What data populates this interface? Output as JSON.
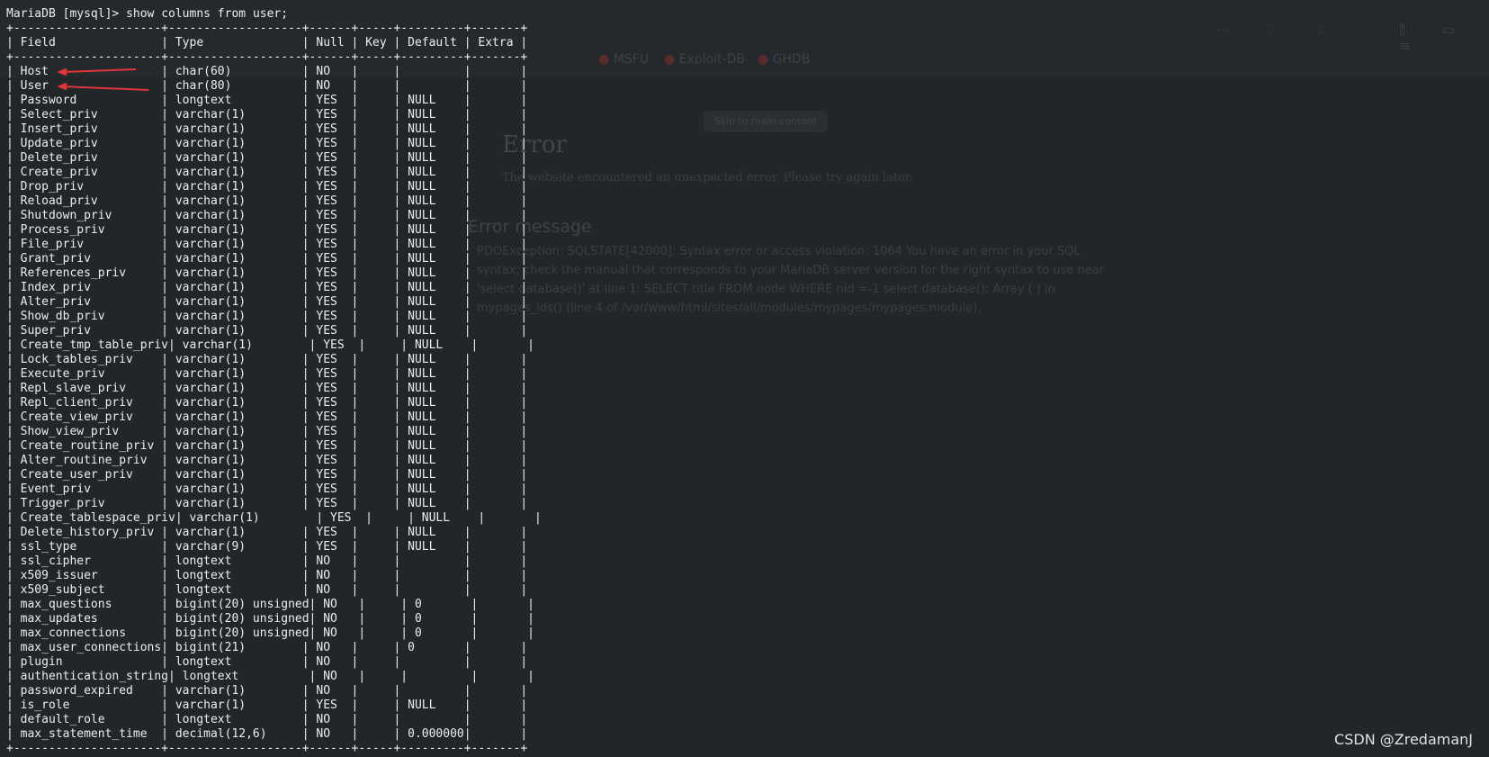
{
  "terminal": {
    "prompt": "MariaDB [mysql]> ",
    "command": "show columns from user;"
  },
  "table": {
    "columns": [
      "Field",
      "Type",
      "Null",
      "Key",
      "Default",
      "Extra"
    ],
    "widths": [
      21,
      19,
      6,
      5,
      9,
      7
    ],
    "rows": [
      [
        "Host",
        "char(60)",
        "NO",
        "",
        "",
        ""
      ],
      [
        "User",
        "char(80)",
        "NO",
        "",
        "",
        ""
      ],
      [
        "Password",
        "longtext",
        "YES",
        "",
        "NULL",
        ""
      ],
      [
        "Select_priv",
        "varchar(1)",
        "YES",
        "",
        "NULL",
        ""
      ],
      [
        "Insert_priv",
        "varchar(1)",
        "YES",
        "",
        "NULL",
        ""
      ],
      [
        "Update_priv",
        "varchar(1)",
        "YES",
        "",
        "NULL",
        ""
      ],
      [
        "Delete_priv",
        "varchar(1)",
        "YES",
        "",
        "NULL",
        ""
      ],
      [
        "Create_priv",
        "varchar(1)",
        "YES",
        "",
        "NULL",
        ""
      ],
      [
        "Drop_priv",
        "varchar(1)",
        "YES",
        "",
        "NULL",
        ""
      ],
      [
        "Reload_priv",
        "varchar(1)",
        "YES",
        "",
        "NULL",
        ""
      ],
      [
        "Shutdown_priv",
        "varchar(1)",
        "YES",
        "",
        "NULL",
        ""
      ],
      [
        "Process_priv",
        "varchar(1)",
        "YES",
        "",
        "NULL",
        ""
      ],
      [
        "File_priv",
        "varchar(1)",
        "YES",
        "",
        "NULL",
        ""
      ],
      [
        "Grant_priv",
        "varchar(1)",
        "YES",
        "",
        "NULL",
        ""
      ],
      [
        "References_priv",
        "varchar(1)",
        "YES",
        "",
        "NULL",
        ""
      ],
      [
        "Index_priv",
        "varchar(1)",
        "YES",
        "",
        "NULL",
        ""
      ],
      [
        "Alter_priv",
        "varchar(1)",
        "YES",
        "",
        "NULL",
        ""
      ],
      [
        "Show_db_priv",
        "varchar(1)",
        "YES",
        "",
        "NULL",
        ""
      ],
      [
        "Super_priv",
        "varchar(1)",
        "YES",
        "",
        "NULL",
        ""
      ],
      [
        "Create_tmp_table_priv",
        "varchar(1)",
        "YES",
        "",
        "NULL",
        ""
      ],
      [
        "Lock_tables_priv",
        "varchar(1)",
        "YES",
        "",
        "NULL",
        ""
      ],
      [
        "Execute_priv",
        "varchar(1)",
        "YES",
        "",
        "NULL",
        ""
      ],
      [
        "Repl_slave_priv",
        "varchar(1)",
        "YES",
        "",
        "NULL",
        ""
      ],
      [
        "Repl_client_priv",
        "varchar(1)",
        "YES",
        "",
        "NULL",
        ""
      ],
      [
        "Create_view_priv",
        "varchar(1)",
        "YES",
        "",
        "NULL",
        ""
      ],
      [
        "Show_view_priv",
        "varchar(1)",
        "YES",
        "",
        "NULL",
        ""
      ],
      [
        "Create_routine_priv",
        "varchar(1)",
        "YES",
        "",
        "NULL",
        ""
      ],
      [
        "Alter_routine_priv",
        "varchar(1)",
        "YES",
        "",
        "NULL",
        ""
      ],
      [
        "Create_user_priv",
        "varchar(1)",
        "YES",
        "",
        "NULL",
        ""
      ],
      [
        "Event_priv",
        "varchar(1)",
        "YES",
        "",
        "NULL",
        ""
      ],
      [
        "Trigger_priv",
        "varchar(1)",
        "YES",
        "",
        "NULL",
        ""
      ],
      [
        "Create_tablespace_priv",
        "varchar(1)",
        "YES",
        "",
        "NULL",
        ""
      ],
      [
        "Delete_history_priv",
        "varchar(1)",
        "YES",
        "",
        "NULL",
        ""
      ],
      [
        "ssl_type",
        "varchar(9)",
        "YES",
        "",
        "NULL",
        ""
      ],
      [
        "ssl_cipher",
        "longtext",
        "NO",
        "",
        "",
        ""
      ],
      [
        "x509_issuer",
        "longtext",
        "NO",
        "",
        "",
        ""
      ],
      [
        "x509_subject",
        "longtext",
        "NO",
        "",
        "",
        ""
      ],
      [
        "max_questions",
        "bigint(20) unsigned",
        "NO",
        "",
        "0",
        ""
      ],
      [
        "max_updates",
        "bigint(20) unsigned",
        "NO",
        "",
        "0",
        ""
      ],
      [
        "max_connections",
        "bigint(20) unsigned",
        "NO",
        "",
        "0",
        ""
      ],
      [
        "max_user_connections",
        "bigint(21)",
        "NO",
        "",
        "0",
        ""
      ],
      [
        "plugin",
        "longtext",
        "NO",
        "",
        "",
        ""
      ],
      [
        "authentication_string",
        "longtext",
        "NO",
        "",
        "",
        ""
      ],
      [
        "password_expired",
        "varchar(1)",
        "NO",
        "",
        "",
        ""
      ],
      [
        "is_role",
        "varchar(1)",
        "YES",
        "",
        "NULL",
        ""
      ],
      [
        "default_role",
        "longtext",
        "NO",
        "",
        "",
        ""
      ],
      [
        "max_statement_time",
        "decimal(12,6)",
        "NO",
        "",
        "0.000000",
        ""
      ]
    ]
  },
  "annotations": {
    "arrow_color": "#e0363a",
    "pointed_rows": [
      "Host",
      "User"
    ]
  },
  "background": {
    "bookmarks": [
      "MSFU",
      "Exploit-DB",
      "GHDB"
    ],
    "skip_button": "Skip to main content",
    "error_title": "Error",
    "error_subtitle": "The website encountered an unexpected error. Please try again later.",
    "message_heading": "Error message",
    "message_lines": [
      "PDOException: SQLSTATE[42000]: Syntax error or access violation: 1064 You have an error in your SQL",
      "syntax; check the manual that corresponds to your MariaDB server version for the right syntax to use near",
      "'select database()' at line 1: SELECT title FROM node WHERE nid =-1 select database(); Array ( ) in",
      "mypages_ids() (line 4 of /var/www/html/sites/all/modules/mypages/mypages.module)."
    ]
  },
  "watermark": "CSDN @ZredamanJ"
}
